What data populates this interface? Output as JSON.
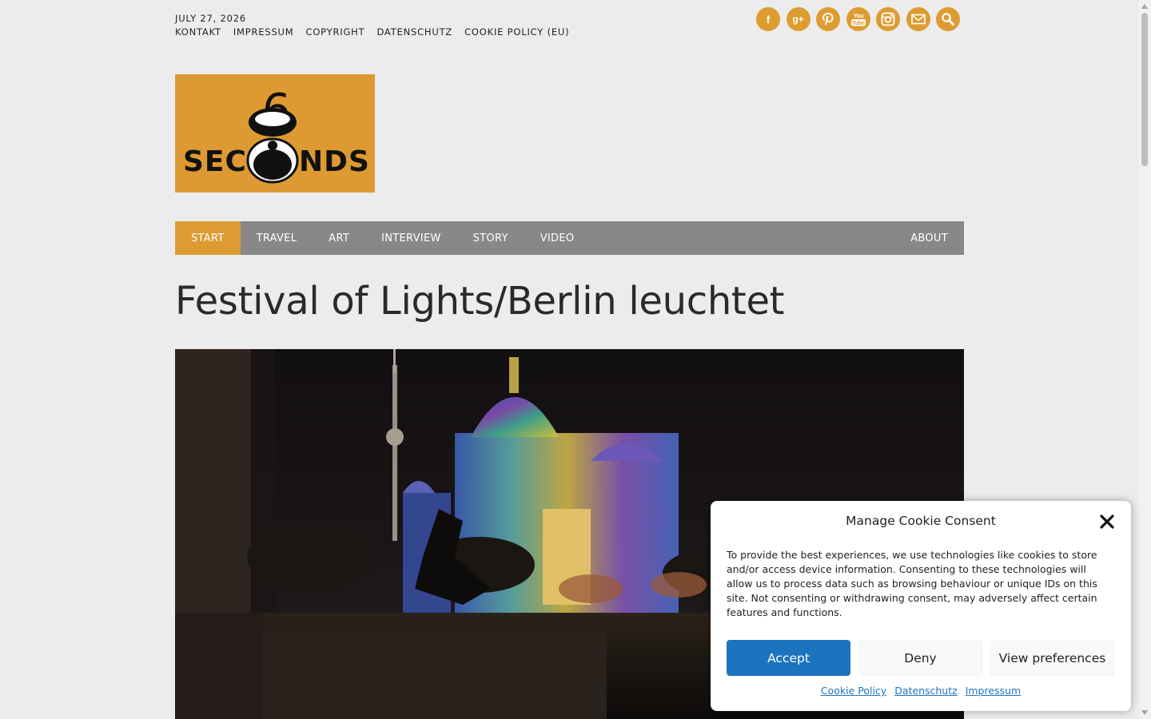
{
  "header": {
    "date": "JULY 27, 2026",
    "top_links": [
      "KONTAKT",
      "IMPRESSUM",
      "COPYRIGHT",
      "DATENSCHUTZ",
      "COOKIE POLICY (EU)"
    ],
    "social_icons": [
      "facebook-icon",
      "google-plus-icon",
      "pinterest-icon",
      "youtube-icon",
      "instagram-icon",
      "mail-icon",
      "search-icon"
    ],
    "youtube_text": "You\nTube"
  },
  "logo": {
    "text": "SEC",
    "text2": "NDS",
    "digit": "6",
    "background": "#dd9a33"
  },
  "nav": {
    "items": [
      "START",
      "TRAVEL",
      "ART",
      "INTERVIEW",
      "STORY",
      "VIDEO"
    ],
    "right_item": "ABOUT",
    "active_index": 0,
    "accent": "#dd9c32",
    "bar_color": "#888888"
  },
  "article": {
    "title": "Festival of Lights/Berlin leuchtet"
  },
  "cookie": {
    "title": "Manage Cookie Consent",
    "body": "To provide the best experiences, we use technologies like cookies to store and/or access device information. Consenting to these technologies will allow us to process data such as browsing behaviour or unique IDs on this site. Not consenting or withdrawing consent, may adversely affect certain features and functions.",
    "accept": "Accept",
    "deny": "Deny",
    "prefs": "View preferences",
    "links": [
      "Cookie Policy",
      "Datenschutz",
      "Impressum"
    ],
    "accent": "#1e73be"
  }
}
